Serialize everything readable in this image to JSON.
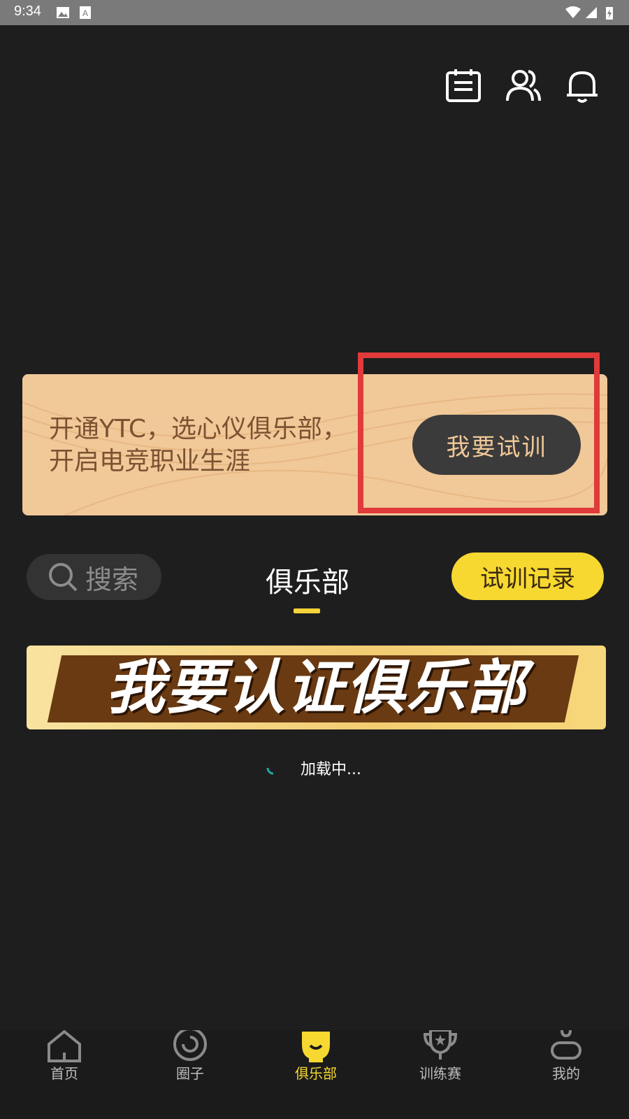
{
  "status_bar": {
    "time": "9:34"
  },
  "header": {
    "icons": [
      "calendar-list-icon",
      "users-icon",
      "bell-icon"
    ]
  },
  "promo": {
    "line1": "开通YTC，选心仪俱乐部，",
    "line2": "开启电竞职业生涯",
    "button_label": "我要试训"
  },
  "tabs": {
    "search_label": "搜索",
    "club_tab_label": "俱乐部",
    "record_button_label": "试训记录"
  },
  "banner": {
    "text": "我要认证俱乐部"
  },
  "loading": {
    "text": "加载中..."
  },
  "bottom_nav": {
    "items": [
      {
        "label": "首页",
        "icon": "home-icon",
        "active": false
      },
      {
        "label": "圈子",
        "icon": "circle-icon",
        "active": false
      },
      {
        "label": "俱乐部",
        "icon": "club-icon",
        "active": true
      },
      {
        "label": "训练赛",
        "icon": "trophy-icon",
        "active": false
      },
      {
        "label": "我的",
        "icon": "profile-icon",
        "active": false
      }
    ]
  },
  "colors": {
    "accent": "#f7d830",
    "promo_bg": "#f1c898",
    "highlight": "#e03a3a"
  }
}
